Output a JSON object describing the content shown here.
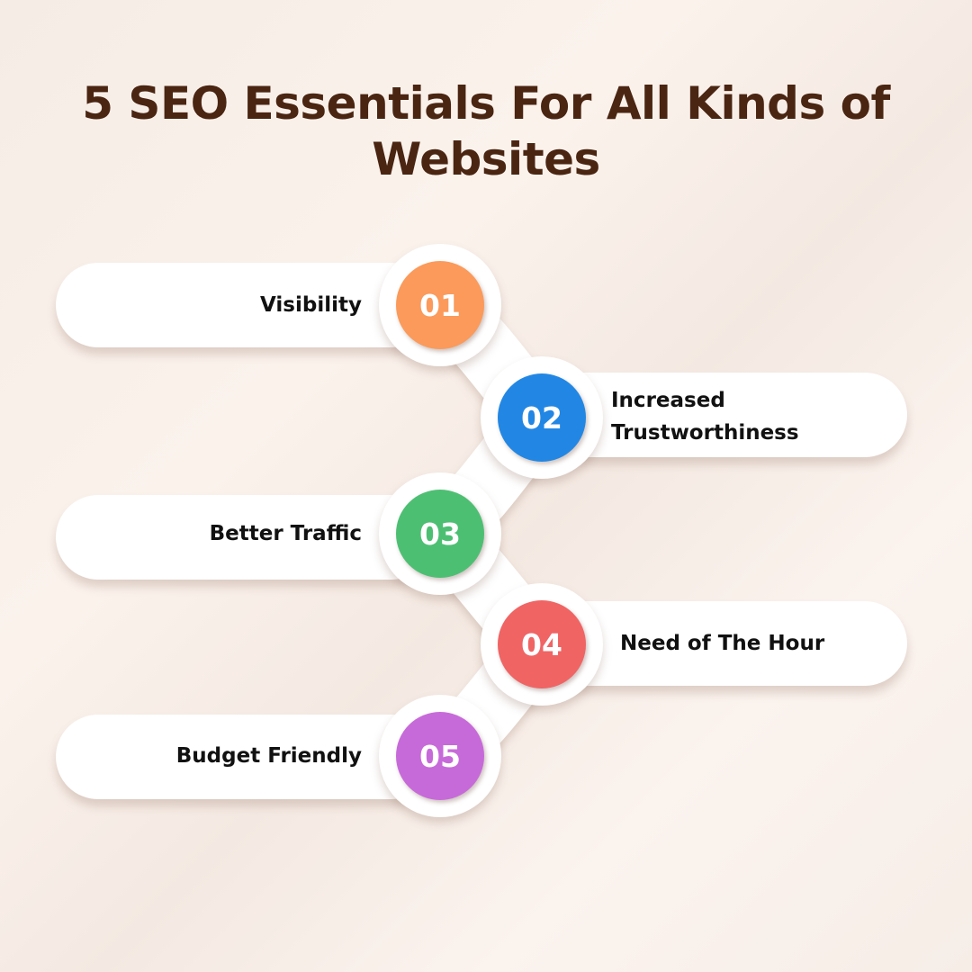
{
  "title": {
    "line1": "5 SEO Essentials For All Kinds of",
    "line2": "Websites"
  },
  "items": [
    {
      "number": "01",
      "label": "Visibility",
      "color": "#fb9a5a",
      "side": "left"
    },
    {
      "number": "02",
      "label_line1": "Increased",
      "label_line2": "Trustworthiness",
      "color": "#2287e4",
      "side": "right"
    },
    {
      "number": "03",
      "label": "Better Traffic",
      "color": "#4dbf73",
      "side": "left"
    },
    {
      "number": "04",
      "label": "Need of The Hour",
      "color": "#f06464",
      "side": "right"
    },
    {
      "number": "05",
      "label": "Budget Friendly",
      "color": "#c76ad9",
      "side": "left"
    }
  ]
}
